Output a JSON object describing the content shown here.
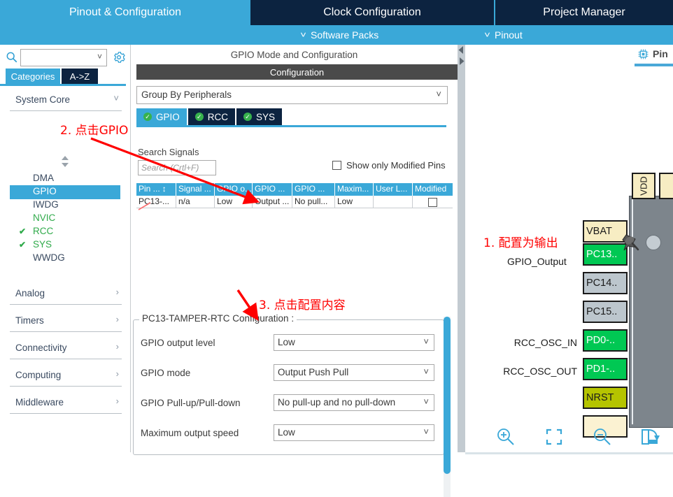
{
  "top_tabs": [
    {
      "label": "Pinout & Configuration",
      "state": "active"
    },
    {
      "label": "Clock Configuration",
      "state": "inactive"
    },
    {
      "label": "Project Manager",
      "state": "inactive"
    }
  ],
  "sub_menu": [
    {
      "label": "Software Packs",
      "icon": "chevron-down-icon"
    },
    {
      "label": "Pinout",
      "icon": "chevron-down-icon"
    }
  ],
  "sidebar": {
    "search": {
      "value": "",
      "placeholder": "",
      "icon": "search-icon"
    },
    "gear_icon": "gear-icon",
    "tabs": [
      {
        "label": "Categories",
        "selected": true
      },
      {
        "label": "A->Z",
        "selected": false
      }
    ],
    "groups": [
      {
        "label": "System Core",
        "expanded": true,
        "chevron": "chevron-down-icon"
      },
      {
        "label": "Analog",
        "expanded": false,
        "chevron": "chevron-right-icon"
      },
      {
        "label": "Timers",
        "expanded": false,
        "chevron": "chevron-right-icon"
      },
      {
        "label": "Connectivity",
        "expanded": false,
        "chevron": "chevron-right-icon"
      },
      {
        "label": "Computing",
        "expanded": false,
        "chevron": "chevron-right-icon"
      },
      {
        "label": "Middleware",
        "expanded": false,
        "chevron": "chevron-right-icon"
      }
    ],
    "peripherals": [
      {
        "label": "DMA",
        "check": false,
        "selected": false,
        "color": "#3a4a60"
      },
      {
        "label": "GPIO",
        "check": false,
        "selected": true,
        "color": "#ffffff"
      },
      {
        "label": "IWDG",
        "check": false,
        "selected": false,
        "color": "#3a4a60"
      },
      {
        "label": "NVIC",
        "check": false,
        "selected": false,
        "color": "#2faa4a"
      },
      {
        "label": "RCC",
        "check": true,
        "selected": false,
        "color": "#2faa4a"
      },
      {
        "label": "SYS",
        "check": true,
        "selected": false,
        "color": "#2faa4a"
      },
      {
        "label": "WWDG",
        "check": false,
        "selected": false,
        "color": "#3a4a60"
      }
    ]
  },
  "center": {
    "title": "GPIO Mode and Configuration",
    "configuration_band": "Configuration",
    "group_by": {
      "value": "Group By Peripherals",
      "chevron": "chevron-down-icon"
    },
    "peripheral_tabs": [
      {
        "label": "GPIO",
        "selected": true,
        "badge": "check-circle-icon"
      },
      {
        "label": "RCC",
        "selected": false,
        "badge": "check-circle-icon"
      },
      {
        "label": "SYS",
        "selected": false,
        "badge": "check-circle-icon"
      }
    ],
    "search_signals_label": "Search Signals",
    "search_signals": {
      "value": "",
      "placeholder": "Search (Crtl+F)"
    },
    "show_only_modified": {
      "label": "Show only Modified Pins",
      "checked": false
    },
    "table": {
      "headers": [
        "Pin ...",
        "Signal ...",
        "GPIO o...",
        "GPIO ...",
        "GPIO ...",
        "Maxim...",
        "User L...",
        "Modified"
      ],
      "sort_column": 0,
      "sort_icon": "sort-updown-icon",
      "rows": [
        {
          "cells": [
            "PC13-...",
            "n/a",
            "Low",
            "Output ...",
            "No pull...",
            "Low",
            "",
            ""
          ],
          "modified_checked": false
        }
      ]
    },
    "config_group": {
      "legend": "PC13-TAMPER-RTC Configuration :",
      "fields": [
        {
          "label": "GPIO output level",
          "value": "Low",
          "chevron": "chevron-down-icon"
        },
        {
          "label": "GPIO mode",
          "value": "Output Push Pull",
          "chevron": "chevron-down-icon"
        },
        {
          "label": "GPIO Pull-up/Pull-down",
          "value": "No pull-up and no pull-down",
          "chevron": "chevron-down-icon"
        },
        {
          "label": "Maximum output speed",
          "value": "Low",
          "chevron": "chevron-down-icon"
        }
      ]
    }
  },
  "right": {
    "pinout_tab": {
      "label": "Pin",
      "icon": "chip-icon"
    },
    "chip_pins_left": [
      {
        "label": "VBAT",
        "color": "cream",
        "signal": ""
      },
      {
        "label": "PC13..",
        "color": "green",
        "signal": ""
      },
      {
        "label": "PC14..",
        "color": "grey",
        "signal": ""
      },
      {
        "label": "PC15..",
        "color": "grey",
        "signal": ""
      },
      {
        "label": "PD0-..",
        "color": "green",
        "signal": "RCC_OSC_IN"
      },
      {
        "label": "PD1-..",
        "color": "green",
        "signal": "RCC_OSC_OUT"
      },
      {
        "label": "NRST",
        "color": "olive",
        "signal": ""
      },
      {
        "label": "",
        "color": "cream2",
        "signal": ""
      }
    ],
    "chip_pins_top": [
      {
        "label": "VDD",
        "color": "cream"
      },
      {
        "label": "",
        "color": "cream"
      }
    ],
    "toolbar": [
      {
        "name": "zoom-in-icon",
        "label": "Zoom In"
      },
      {
        "name": "fit-screen-icon",
        "label": "Fit To Screen"
      },
      {
        "name": "zoom-out-icon",
        "label": "Zoom Out"
      },
      {
        "name": "export-image-icon",
        "label": "Export Image"
      }
    ]
  },
  "annotations": [
    {
      "id": "step1",
      "text": "1. 配置为输出",
      "color": "#ff0000"
    },
    {
      "id": "step1sub",
      "text": "GPIO_Output",
      "color": "#1b1b1b"
    },
    {
      "id": "step2",
      "text": "2. 点击GPIO",
      "color": "#ff0000"
    },
    {
      "id": "step3",
      "text": "3. 点击配置内容",
      "color": "#ff0000"
    }
  ],
  "colors": {
    "accent": "#3aa8d8",
    "dark_tab": "#0c2340",
    "green_pin": "#00c853",
    "annotation_red": "#ff0000"
  }
}
